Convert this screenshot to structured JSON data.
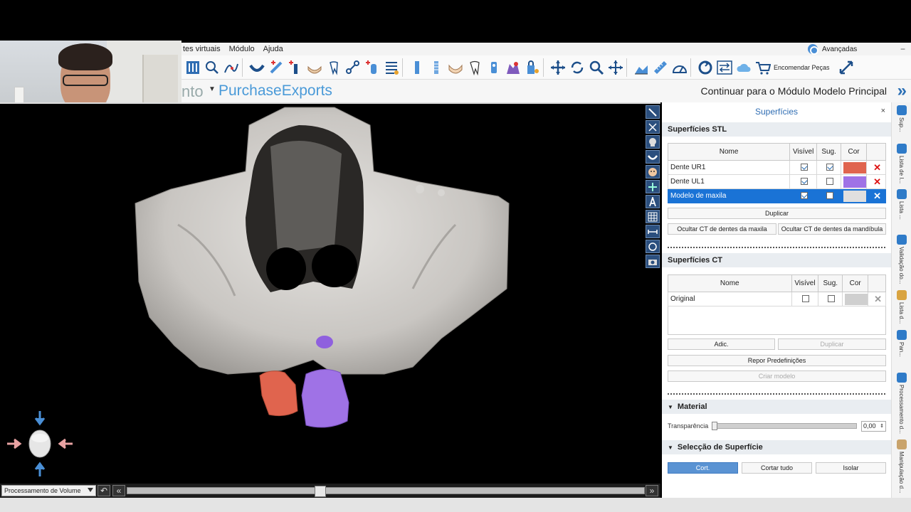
{
  "menu": {
    "items": [
      "tes virtuais",
      "Módulo",
      "Ajuda"
    ],
    "advanced": "Avançadas",
    "minimize": "−"
  },
  "toolbar": {
    "order_parts": "Encomendar Peças"
  },
  "brandbar": {
    "mode_fragment": "nto",
    "brand": "PurchaseExports",
    "continue": "Continuar para o Módulo Modelo Principal"
  },
  "viewport": {
    "volume_mode": "Processamento de Volume",
    "slider_fraction": 0.37
  },
  "panel": {
    "title": "Superfícies",
    "close": "×",
    "stl": {
      "header": "Superfícies STL",
      "columns": [
        "Nome",
        "Visível",
        "Sug.",
        "Cor"
      ],
      "rows": [
        {
          "name": "Dente UR1",
          "visible": true,
          "sug": true,
          "color": "#e0644e",
          "selected": false
        },
        {
          "name": "Dente UL1",
          "visible": true,
          "sug": false,
          "color": "#9f72e6",
          "selected": false
        },
        {
          "name": "Modelo de maxila",
          "visible": true,
          "sug": false,
          "color": "#e0dfdf",
          "selected": true
        }
      ],
      "duplicate": "Duplicar",
      "hide_maxilla": "Ocultar CT de dentes da maxila",
      "hide_mandible": "Ocultar CT de dentes da mandíbula"
    },
    "ct": {
      "header": "Superfícies CT",
      "columns": [
        "Nome",
        "Visível",
        "Sug.",
        "Cor"
      ],
      "rows": [
        {
          "name": "Original",
          "visible": false,
          "sug": false,
          "color": "#cfcfcf"
        }
      ],
      "add": "Adic.",
      "duplicate": "Duplicar",
      "reset": "Repor Predefinições",
      "create_model": "Criar modelo"
    },
    "material": {
      "header": "Material",
      "transparency_label": "Transparência",
      "transparency_value": "0,00"
    },
    "selection": {
      "header": "Selecção de Superfície",
      "cut": "Cort.",
      "cut_all": "Cortar tudo",
      "isolate": "Isolar"
    }
  },
  "side_tabs": [
    {
      "label": "Sup...",
      "color": "#2f7bc8"
    },
    {
      "label": "Lista de I...",
      "color": "#2f7bc8"
    },
    {
      "label": "Lista ...",
      "color": "#2f7bc8"
    },
    {
      "label": "Validação do...",
      "color": "#2f7bc8"
    },
    {
      "label": "Lista d...",
      "color": "#d9a441"
    },
    {
      "label": "Pan...",
      "color": "#2f7bc8"
    },
    {
      "label": "Processamento d...",
      "color": "#2f7bc8"
    },
    {
      "label": "Manipulação d...",
      "color": "#c9a36b"
    }
  ],
  "colors": {
    "accent": "#2f6db3",
    "selection": "#1a73d6",
    "tooth_right": "#e0644e",
    "tooth_left": "#9f72e6"
  }
}
